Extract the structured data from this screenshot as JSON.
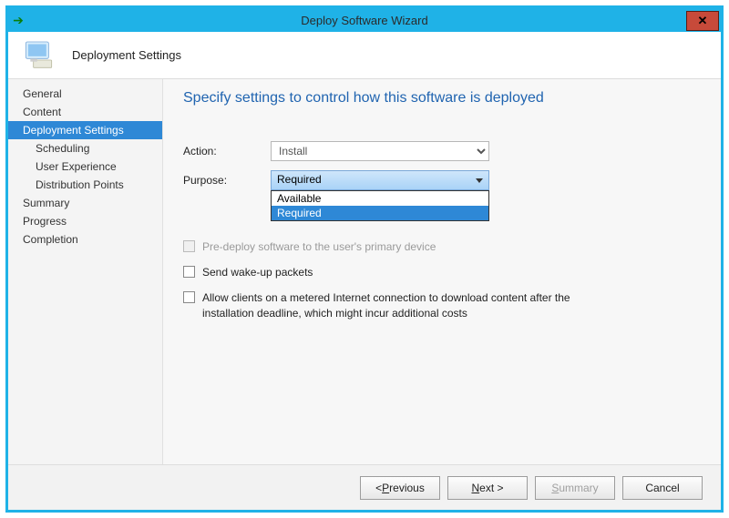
{
  "window": {
    "title": "Deploy Software Wizard",
    "page_name": "Deployment Settings"
  },
  "sidebar": {
    "items": [
      {
        "label": "General",
        "level": 0,
        "active": false
      },
      {
        "label": "Content",
        "level": 0,
        "active": false
      },
      {
        "label": "Deployment Settings",
        "level": 0,
        "active": true
      },
      {
        "label": "Scheduling",
        "level": 1,
        "active": false
      },
      {
        "label": "User Experience",
        "level": 1,
        "active": false
      },
      {
        "label": "Distribution Points",
        "level": 1,
        "active": false
      },
      {
        "label": "Summary",
        "level": 0,
        "active": false
      },
      {
        "label": "Progress",
        "level": 0,
        "active": false
      },
      {
        "label": "Completion",
        "level": 0,
        "active": false
      }
    ]
  },
  "content": {
    "instruction": "Specify settings to control how this software is deployed",
    "action_label": "Action:",
    "action_value": "Install",
    "purpose_label": "Purpose:",
    "purpose_selected": "Required",
    "purpose_options": {
      "opt0": "Available",
      "opt1": "Required"
    },
    "predeploy_label": "Pre-deploy software to the user's primary device",
    "wakeup_label": "Send wake-up packets",
    "metered_label": "Allow clients on a metered Internet connection to download content after the installation deadline, which might incur additional costs"
  },
  "footer": {
    "previous_pre": "< ",
    "previous_mn": "P",
    "previous_post": "revious",
    "next_mn": "N",
    "next_post": "ext >",
    "summary_mn": "S",
    "summary_post": "ummary",
    "cancel": "Cancel"
  }
}
